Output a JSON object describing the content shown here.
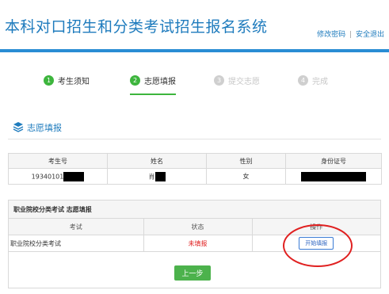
{
  "header": {
    "title": "本科对口招生和分类考试招生报名系统",
    "link_change_password": "修改密码",
    "link_separator": "|",
    "link_logout": "安全退出"
  },
  "steps": [
    {
      "num": "1",
      "label": "考生须知",
      "state": "done"
    },
    {
      "num": "2",
      "label": "志愿填报",
      "state": "current"
    },
    {
      "num": "3",
      "label": "提交志愿",
      "state": "inactive"
    },
    {
      "num": "4",
      "label": "完成",
      "state": "inactive"
    }
  ],
  "section": {
    "title": "志愿填报",
    "icon": "layers-icon"
  },
  "info_table": {
    "headers": [
      "考生号",
      "姓名",
      "性别",
      "身份证号"
    ],
    "row": {
      "exam_id": "19340101",
      "name": "肖",
      "gender": "女",
      "id_number": ""
    }
  },
  "form_box": {
    "title": "职业院校分类考试 志愿填报",
    "headers": [
      "考试",
      "状态",
      "操作"
    ],
    "row": {
      "exam": "职业院校分类考试",
      "status": "未填报",
      "action": "开始填报"
    }
  },
  "back_button": "上一步",
  "colors": {
    "brand": "#1e7bbd",
    "header_line": "#2a8dd4",
    "step_active": "#3db53d",
    "status_red": "#e02020",
    "button_green": "#4cb24c"
  }
}
